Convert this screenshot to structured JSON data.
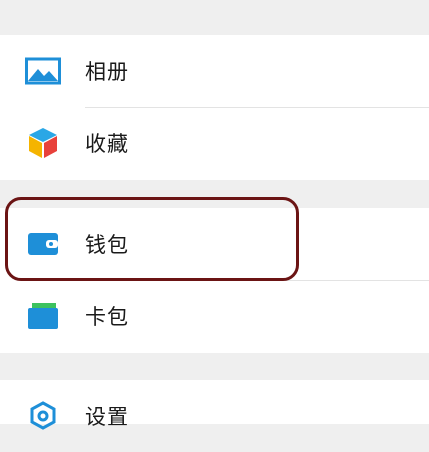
{
  "menu": {
    "group1": [
      {
        "label": "相册",
        "icon": "photo-album-icon"
      },
      {
        "label": "收藏",
        "icon": "favorites-cube-icon"
      }
    ],
    "group2": [
      {
        "label": "钱包",
        "icon": "wallet-icon"
      },
      {
        "label": "卡包",
        "icon": "card-wallet-icon"
      }
    ],
    "group3": [
      {
        "label": "设置",
        "icon": "settings-gear-icon"
      }
    ]
  },
  "colors": {
    "accent_blue": "#1e8fd8",
    "highlight_border": "#6b1414",
    "background": "#efefef"
  }
}
